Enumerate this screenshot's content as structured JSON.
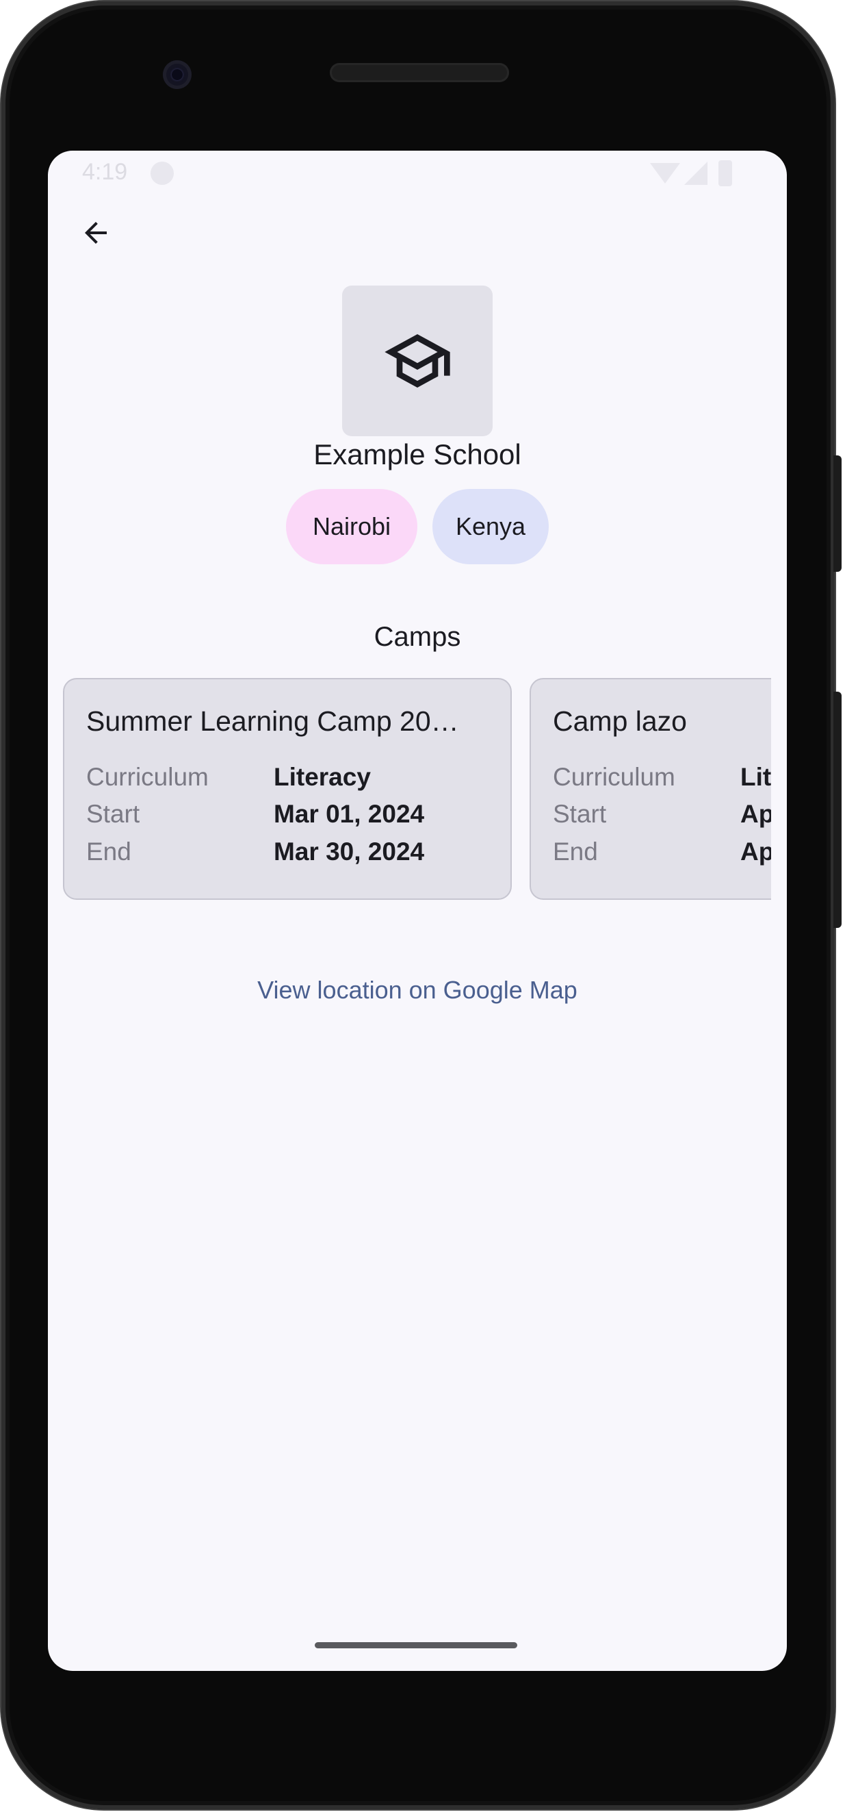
{
  "status_bar": {
    "time": "4:19"
  },
  "school": {
    "name": "Example School",
    "icon": "graduation-cap-icon"
  },
  "chips": [
    {
      "label": "Nairobi",
      "color": "#fbd8f8"
    },
    {
      "label": "Kenya",
      "color": "#dde1f9"
    }
  ],
  "camps": {
    "heading": "Camps",
    "cards": [
      {
        "title": "Summer Learning Camp 20…",
        "rows": [
          {
            "key": "Curriculum",
            "value": "Literacy"
          },
          {
            "key": "Start",
            "value": "Mar 01, 2024"
          },
          {
            "key": "End",
            "value": "Mar 30, 2024"
          }
        ]
      },
      {
        "title": "Camp lazo",
        "rows": [
          {
            "key": "Curriculum",
            "value": "Lit"
          },
          {
            "key": "Start",
            "value": "Ap"
          },
          {
            "key": "End",
            "value": "Ap"
          }
        ]
      }
    ]
  },
  "map_link": "View location on Google Map",
  "colors": {
    "background": "#f8f7fc",
    "link": "#4a5f8f",
    "card": "#e2e1e9"
  }
}
